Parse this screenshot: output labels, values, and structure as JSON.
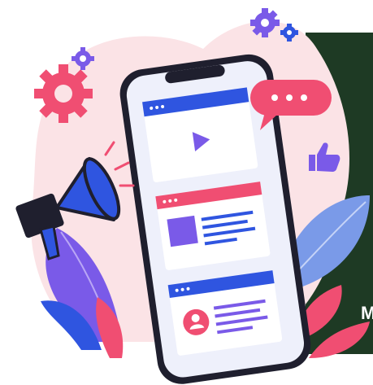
{
  "illustration": {
    "subject": "smartphone-social-media-marketing",
    "colors": {
      "phone_frame": "#1f1f2e",
      "screen": "#eef0fb",
      "blue": "#2f55e0",
      "pink": "#f04e72",
      "purple": "#7a5ae8",
      "background_blob": "#fbe3e6",
      "dark_panel": "#1e3a24"
    },
    "icons": [
      "megaphone-icon",
      "gear-icon",
      "chat-bubble-icon",
      "thumbs-up-icon",
      "play-icon",
      "avatar-icon",
      "leaf-icon"
    ],
    "watermark_text": "M"
  }
}
